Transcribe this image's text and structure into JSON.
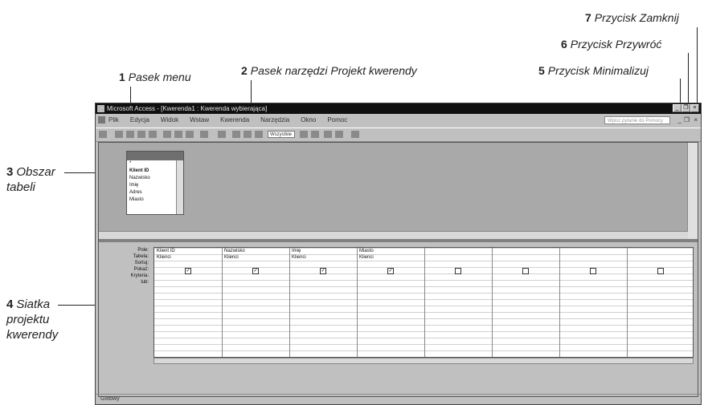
{
  "callouts": {
    "c1": {
      "num": "1",
      "text": "Pasek menu"
    },
    "c2": {
      "num": "2",
      "text": "Pasek narzędzi Projekt kwerendy"
    },
    "c3": {
      "num": "3",
      "text": "Obszar tabeli"
    },
    "c4": {
      "num": "4",
      "text": "Siatka projektu kwerendy"
    },
    "c5": {
      "num": "5",
      "text": "Przycisk Minimalizuj"
    },
    "c6": {
      "num": "6",
      "text": "Przycisk Przywróć"
    },
    "c7": {
      "num": "7",
      "text": "Przycisk Zamknij"
    }
  },
  "window": {
    "title": "Microsoft Access - [Kwerenda1 : Kwerenda wybierająca]",
    "minimize": "_",
    "restore": "❐",
    "close": "×"
  },
  "menu": [
    "Plik",
    "Edycja",
    "Widok",
    "Wstaw",
    "Kwerenda",
    "Narzędzia",
    "Okno",
    "Pomoc"
  ],
  "help_placeholder": "Wpisz pytanie do Pomocy",
  "toolbar": {
    "dropdown": "Wszystkie"
  },
  "table_fields": [
    "*",
    "Klient ID",
    "Nazwisko",
    "Imię",
    "Adres",
    "Miasto"
  ],
  "row_labels": [
    "Pole:",
    "Tabela:",
    "Sortuj:",
    "Pokaż:",
    "Kryteria:",
    "lub:"
  ],
  "grid_columns": [
    {
      "field": "Klient ID",
      "table": "Klienci",
      "show": true
    },
    {
      "field": "Nazwisko",
      "table": "Klienci",
      "show": true
    },
    {
      "field": "Imię",
      "table": "Klienci",
      "show": true
    },
    {
      "field": "Miasto",
      "table": "Klienci",
      "show": true
    },
    {
      "field": "",
      "table": "",
      "show": false
    },
    {
      "field": "",
      "table": "",
      "show": false
    },
    {
      "field": "",
      "table": "",
      "show": false
    },
    {
      "field": "",
      "table": "",
      "show": false
    }
  ],
  "status": "Gotowy"
}
